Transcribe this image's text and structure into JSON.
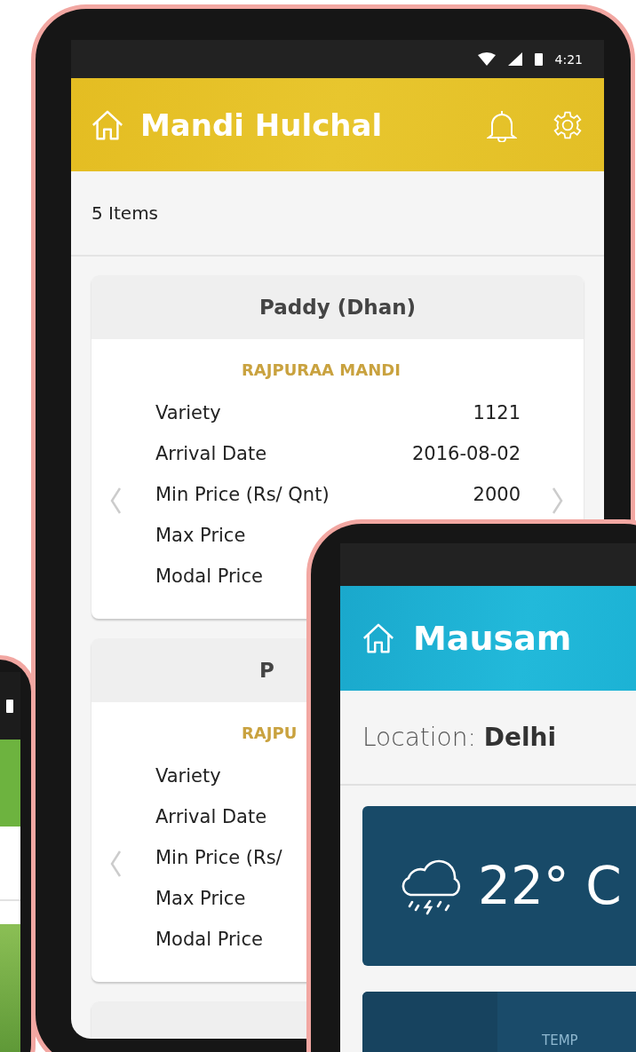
{
  "mandi_app": {
    "status_bar": {
      "time": "4:21"
    },
    "header": {
      "title": "Mandi Hulchal"
    },
    "item_count": "5 Items",
    "cards": [
      {
        "title": "Paddy (Dhan)",
        "mandi": "RAJPURAA MANDI",
        "rows": [
          {
            "label": "Variety",
            "value": "1121"
          },
          {
            "label": "Arrival Date",
            "value": "2016-08-02"
          },
          {
            "label": "Min Price (Rs/ Qnt)",
            "value": "2000"
          },
          {
            "label": "Max Price"
          },
          {
            "label": "Modal Price"
          }
        ]
      },
      {
        "title": "P",
        "mandi": "RAJPU",
        "rows": [
          {
            "label": "Variety"
          },
          {
            "label": "Arrival Date"
          },
          {
            "label": "Min Price (Rs/"
          },
          {
            "label": "Max Price"
          },
          {
            "label": "Modal Price"
          }
        ]
      }
    ]
  },
  "mausam_app": {
    "header": {
      "title": "Mausam"
    },
    "location": "Location: **Delhi**",
    "weather": {
      "temperature": "22° C"
    },
    "stats": {
      "label": "TEMP"
    }
  }
}
